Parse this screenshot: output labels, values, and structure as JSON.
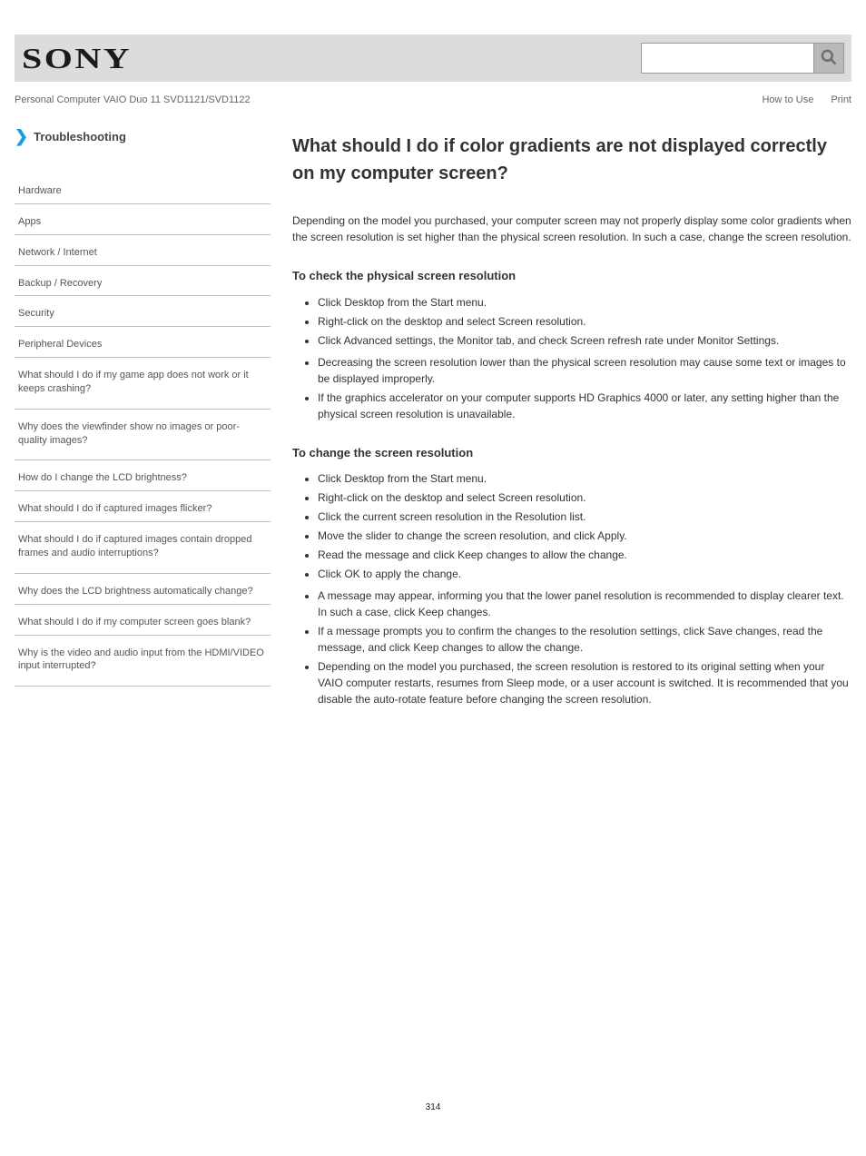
{
  "header": {
    "brand": "Sony",
    "product": "Personal Computer  VAIO Duo 11 SVD1121/SVD1122",
    "links": {
      "howto": "How to Use",
      "print": "Print"
    }
  },
  "search": {
    "placeholder": "",
    "value": ""
  },
  "sidebar": {
    "heading": "Troubleshooting",
    "items": [
      {
        "label": "Hardware"
      },
      {
        "label": "Apps"
      },
      {
        "label": "Network / Internet"
      },
      {
        "label": "Backup / Recovery"
      },
      {
        "label": "Security"
      },
      {
        "label": "Peripheral Devices"
      },
      {
        "label": "What should I do if my game app does not work or it keeps crashing?"
      },
      {
        "label": "Why does the viewfinder show no images or poor-quality images?"
      },
      {
        "label": "How do I change the LCD brightness?"
      },
      {
        "label": "What should I do if captured images flicker?"
      },
      {
        "label": "What should I do if captured images contain dropped frames and audio interruptions?"
      },
      {
        "label": "Why does the LCD brightness automatically change?"
      },
      {
        "label": "What should I do if my computer screen goes blank?"
      },
      {
        "label": "Why is the video and audio input from the HDMI/VIDEO input interrupted?"
      }
    ]
  },
  "article": {
    "title": "What should I do if color gradients are not displayed correctly on my computer screen?",
    "body": [
      {
        "type": "p",
        "text": "Depending on the model you purchased, your computer screen may not properly display some color gradients when the screen resolution is set higher than the physical screen resolution. In such a case, change the screen resolution."
      },
      {
        "type": "h2",
        "text": "To check the physical screen resolution"
      },
      {
        "type": "ul",
        "items": [
          "Click Desktop from the Start menu.",
          "Right-click on the desktop and select Screen resolution.",
          "Click Advanced settings, the Monitor tab, and check Screen refresh rate under Monitor Settings."
        ]
      },
      {
        "type": "ul",
        "items": [
          "Decreasing the screen resolution lower than the physical screen resolution may cause some text or images to be displayed improperly.",
          "If the graphics accelerator on your computer supports HD Graphics 4000 or later, any setting higher than the physical screen resolution is unavailable."
        ]
      },
      {
        "type": "h2",
        "text": "To change the screen resolution"
      },
      {
        "type": "ul",
        "items": [
          "Click Desktop from the Start menu.",
          "Right-click on the desktop and select Screen resolution.",
          "Click the current screen resolution in the Resolution list.",
          "Move the slider to change the screen resolution, and click Apply.",
          "Read the message and click Keep changes to allow the change.",
          "Click OK to apply the change."
        ]
      },
      {
        "type": "ul",
        "items": [
          "A message may appear, informing you that the lower panel resolution is recommended to display clearer text. In such a case, click Keep changes.",
          "If a message prompts you to confirm the changes to the resolution settings, click Save changes, read the message, and click Keep changes to allow the change.",
          "Depending on the model you purchased, the screen resolution is restored to its original setting when your VAIO computer restarts, resumes from Sleep mode, or a user account is switched. It is recommended that you disable the auto-rotate feature before changing the screen resolution."
        ]
      }
    ]
  },
  "pageNumber": "314"
}
